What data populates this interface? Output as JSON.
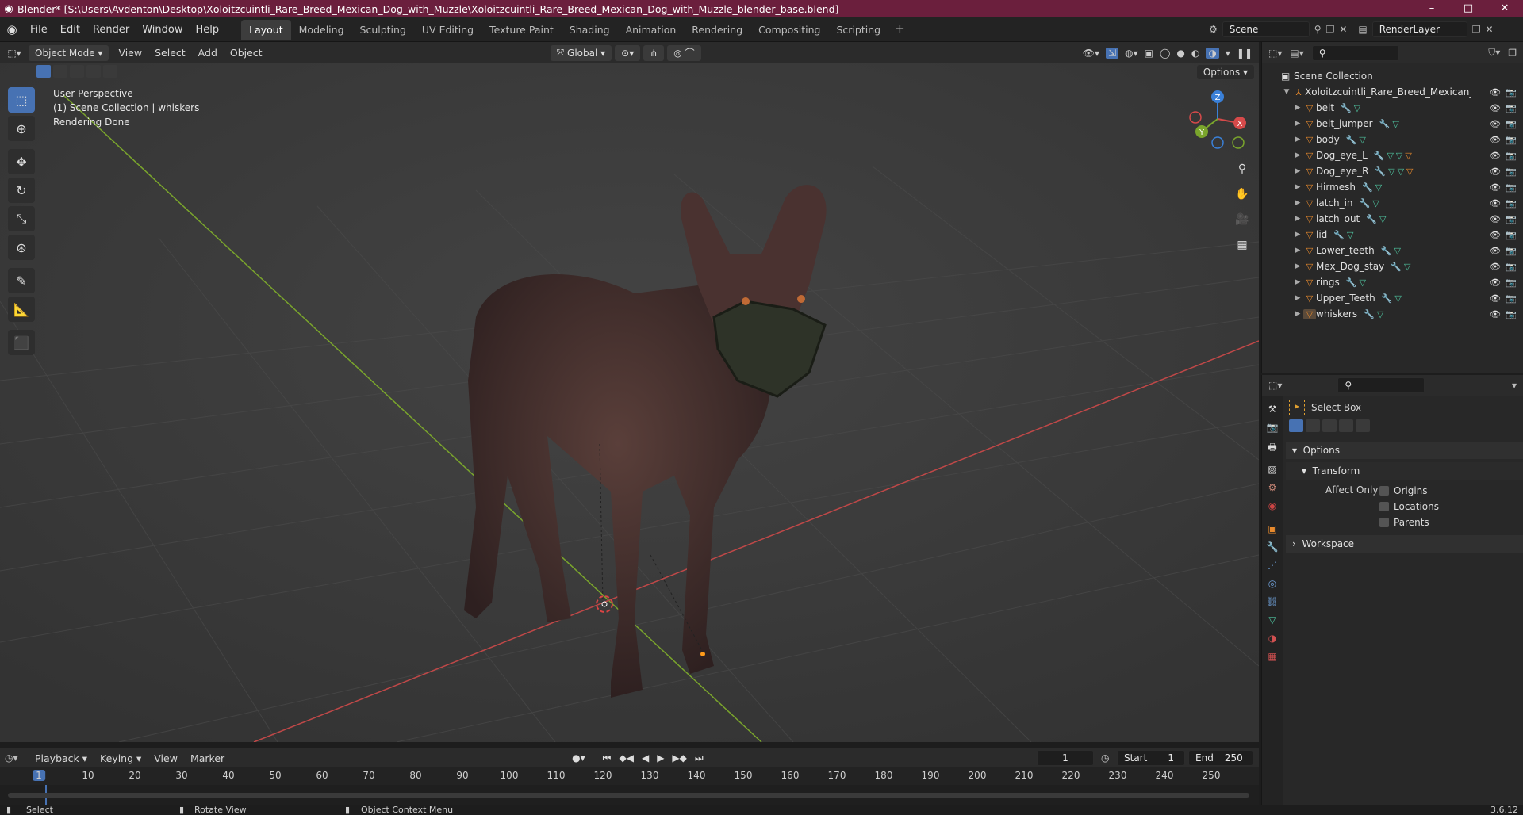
{
  "window": {
    "title": "Blender* [S:\\Users\\Avdenton\\Desktop\\Xoloitzcuintli_Rare_Breed_Mexican_Dog_with_Muzzle\\Xoloitzcuintli_Rare_Breed_Mexican_Dog_with_Muzzle_blender_base.blend]",
    "min": "–",
    "max": "□",
    "close": "✕"
  },
  "menu": [
    "File",
    "Edit",
    "Render",
    "Window",
    "Help"
  ],
  "workspaces": [
    "Layout",
    "Modeling",
    "Sculpting",
    "UV Editing",
    "Texture Paint",
    "Shading",
    "Animation",
    "Rendering",
    "Compositing",
    "Scripting"
  ],
  "active_workspace": "Layout",
  "scene": {
    "name": "Scene",
    "view_layer": "RenderLayer"
  },
  "viewport_header": {
    "mode": "Object Mode",
    "menus": [
      "View",
      "Select",
      "Add",
      "Object"
    ],
    "orientation": "Global",
    "options": "Options"
  },
  "viewport_info": {
    "line1": "User Perspective",
    "line2": "(1) Scene Collection | whiskers",
    "line3": "Rendering Done"
  },
  "gizmo": {
    "x": "X",
    "y": "Y",
    "z": "Z"
  },
  "outliner": {
    "root": "Scene Collection",
    "collection": "Xoloitzcuintli_Rare_Breed_Mexican_Dog",
    "objects": [
      "belt",
      "belt_jumper",
      "body",
      "Dog_eye_L",
      "Dog_eye_R",
      "Hirmesh",
      "latch_in",
      "latch_out",
      "lid",
      "Lower_teeth",
      "Mex_Dog_stay",
      "rings",
      "Upper_Teeth",
      "whiskers"
    ]
  },
  "properties": {
    "tool": "Select Box",
    "options_panel": "Options",
    "transform_panel": "Transform",
    "affect_only": "Affect Only",
    "checks": [
      "Origins",
      "Locations",
      "Parents"
    ],
    "workspace_panel": "Workspace"
  },
  "timeline": {
    "menus": [
      "Playback",
      "Keying",
      "View",
      "Marker"
    ],
    "current_frame": "1",
    "start_label": "Start",
    "start": "1",
    "end_label": "End",
    "end": "250",
    "ticks": [
      "10",
      "20",
      "30",
      "40",
      "50",
      "60",
      "70",
      "80",
      "90",
      "100",
      "110",
      "120",
      "130",
      "140",
      "150",
      "160",
      "170",
      "180",
      "190",
      "200",
      "210",
      "220",
      "230",
      "240",
      "250"
    ]
  },
  "statusbar": {
    "select": "Select",
    "rotate": "Rotate View",
    "context": "Object Context Menu",
    "version": "3.6.12"
  },
  "colors": {
    "titlebar": "#6b1f3d",
    "accent": "#4772b3",
    "x_axis": "#d64a4a",
    "y_axis": "#7aa52c",
    "z_axis": "#3a80d8"
  }
}
